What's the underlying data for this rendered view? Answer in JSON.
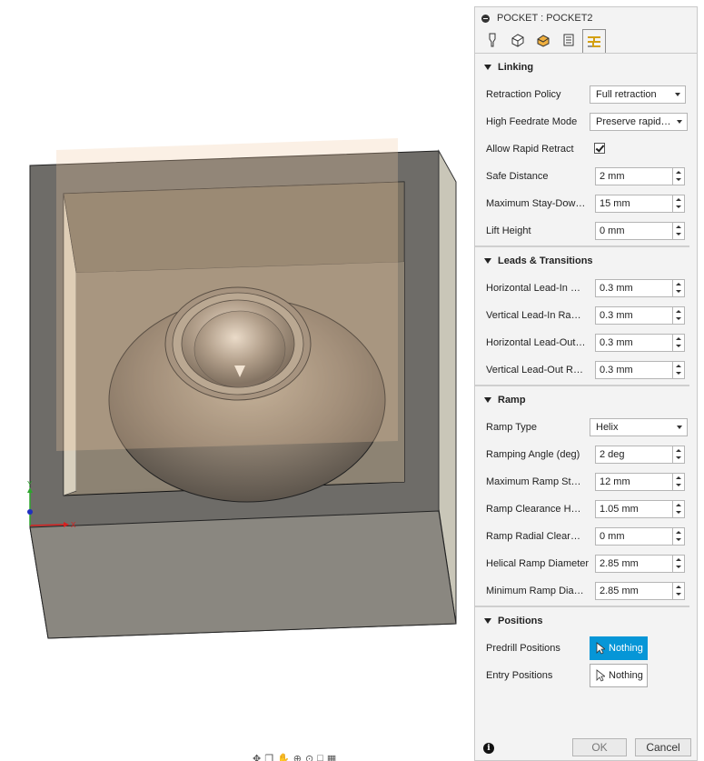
{
  "panel": {
    "title": "POCKET : POCKET2",
    "tabs": [
      {
        "name": "tool-tab-icon",
        "active": false
      },
      {
        "name": "geometry-tab-icon",
        "active": false
      },
      {
        "name": "heights-tab-icon",
        "active": false
      },
      {
        "name": "passes-tab-icon",
        "active": false
      },
      {
        "name": "linking-tab-icon",
        "active": true
      }
    ],
    "linking": {
      "title": "Linking",
      "retraction_policy": {
        "label": "Retraction Policy",
        "value": "Full retraction"
      },
      "high_feedrate_mode": {
        "label": "High Feedrate Mode",
        "value": "Preserve rapid r..."
      },
      "allow_rapid_retract": {
        "label": "Allow Rapid Retract",
        "checked": true
      },
      "safe_distance": {
        "label": "Safe Distance",
        "value": "2 mm"
      },
      "max_stay_down": {
        "label": "Maximum Stay-Down Distance",
        "value": "15 mm"
      },
      "lift_height": {
        "label": "Lift Height",
        "value": "0 mm"
      }
    },
    "leads": {
      "title": "Leads & Transitions",
      "h_lead_in": {
        "label": "Horizontal Lead-In Radius",
        "value": "0.3 mm"
      },
      "v_lead_in": {
        "label": "Vertical Lead-In Radius",
        "value": "0.3 mm"
      },
      "h_lead_out": {
        "label": "Horizontal Lead-Out Radius",
        "value": "0.3 mm"
      },
      "v_lead_out": {
        "label": "Vertical Lead-Out Radius",
        "value": "0.3 mm"
      }
    },
    "ramp": {
      "title": "Ramp",
      "ramp_type": {
        "label": "Ramp Type",
        "value": "Helix"
      },
      "ramping_angle": {
        "label": "Ramping Angle (deg)",
        "value": "2 deg"
      },
      "max_ramp_stepdown": {
        "label": "Maximum Ramp Stepdown",
        "value": "12 mm"
      },
      "ramp_clearance_height": {
        "label": "Ramp Clearance Height",
        "value": "1.05 mm"
      },
      "ramp_radial_clearance": {
        "label": "Ramp Radial Clearance",
        "value": "0 mm"
      },
      "helical_ramp_diameter": {
        "label": "Helical Ramp Diameter",
        "value": "2.85 mm"
      },
      "min_ramp_diameter": {
        "label": "Minimum Ramp Diameter",
        "value": "2.85 mm"
      }
    },
    "positions": {
      "title": "Positions",
      "predrill": {
        "label": "Predrill Positions",
        "value": "Nothing"
      },
      "entry": {
        "label": "Entry Positions",
        "value": "Nothing"
      }
    },
    "footer": {
      "ok": "OK",
      "cancel": "Cancel"
    }
  },
  "viewport": {
    "axis_x": "X",
    "axis_y": "Y",
    "axis_colors": {
      "x": "#d62020",
      "y": "#2da52d",
      "z": "#2030c0"
    }
  }
}
